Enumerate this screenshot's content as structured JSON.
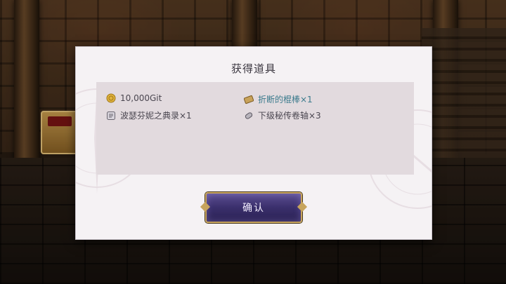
{
  "dialog": {
    "title": "获得道具",
    "confirm_label": "确认"
  },
  "rewards": [
    {
      "icon": "gold-coin-icon",
      "label": "10,000Git",
      "highlight": false
    },
    {
      "icon": "broken-stick-icon",
      "label": "折断的棍棒×1",
      "highlight": true
    },
    {
      "icon": "tome-icon",
      "label": "波瑟芬妮之典录×1",
      "highlight": false
    },
    {
      "icon": "scroll-icon",
      "label": "下级秘传卷轴×3",
      "highlight": false
    }
  ],
  "colors": {
    "highlight_text": "#3a7a8c",
    "button_bg": "#3a2f6c",
    "button_border": "#c7a45c"
  }
}
